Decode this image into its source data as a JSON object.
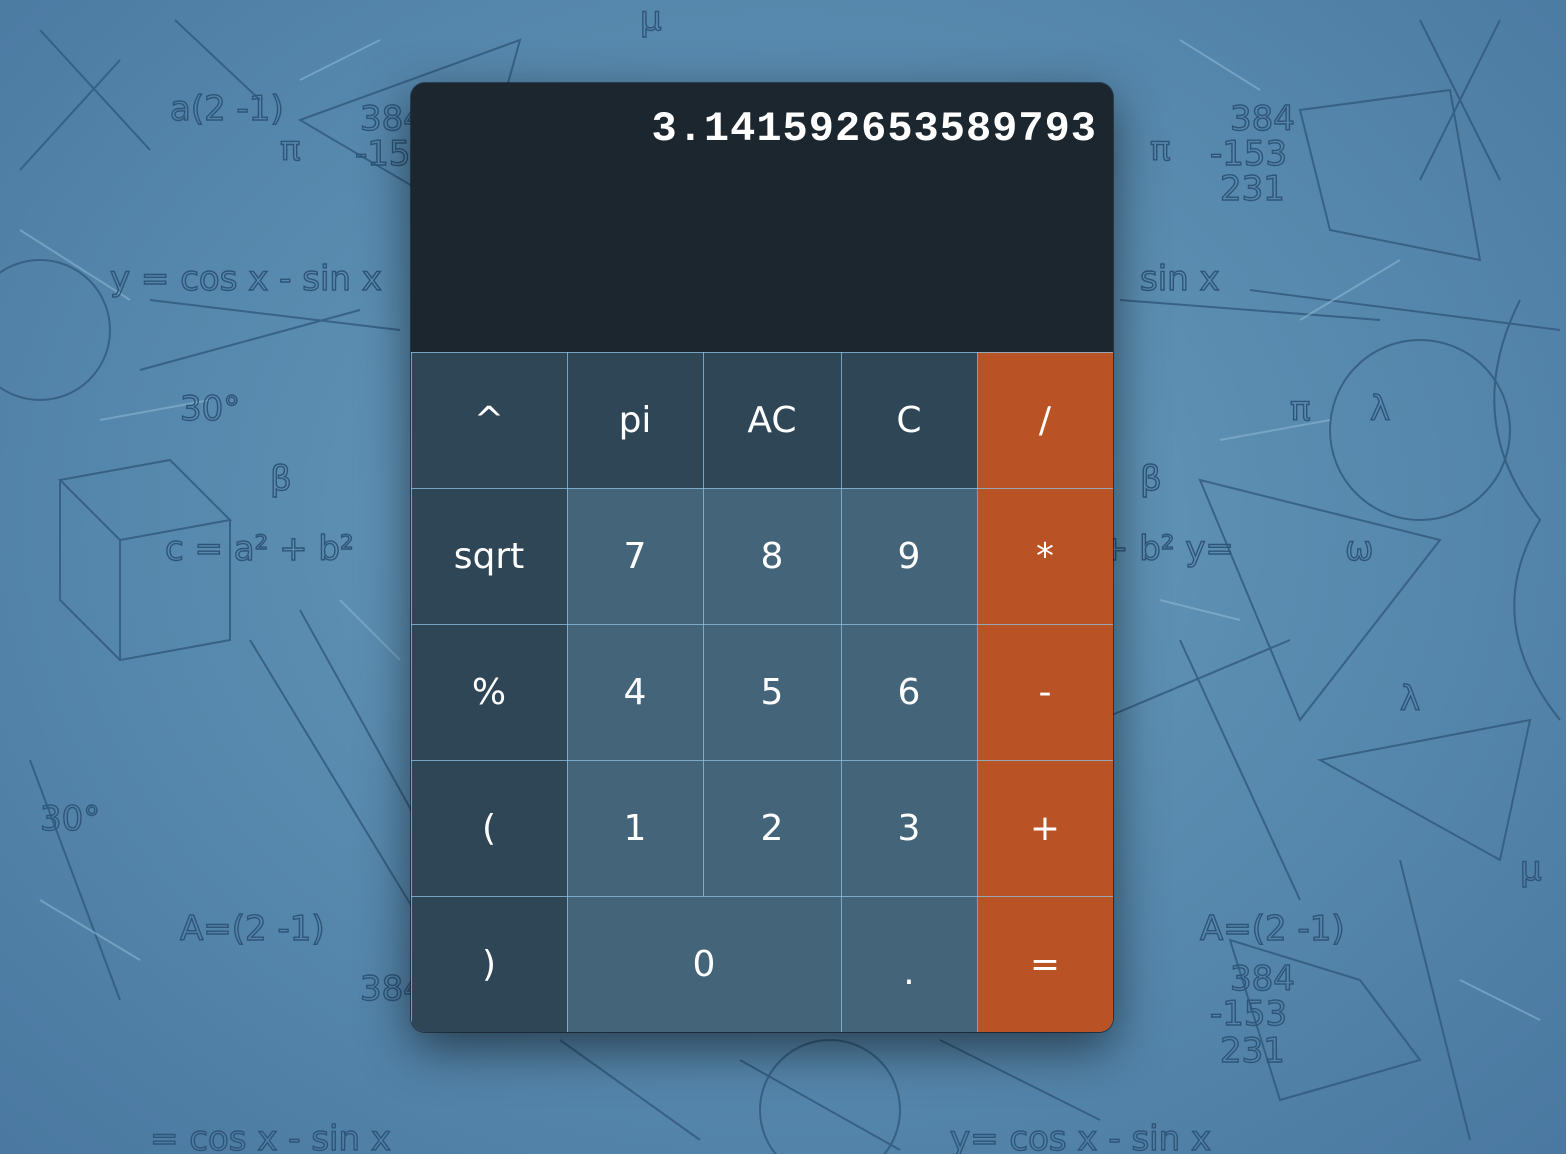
{
  "display": {
    "value": "3.141592653589793"
  },
  "keypad": {
    "rows": [
      [
        {
          "label": "^",
          "kind": "fn",
          "name": "power-key"
        },
        {
          "label": "pi",
          "kind": "fn",
          "name": "pi-key"
        },
        {
          "label": "AC",
          "kind": "fn",
          "name": "all-clear-key"
        },
        {
          "label": "C",
          "kind": "fn",
          "name": "clear-key"
        },
        {
          "label": "/",
          "kind": "op",
          "name": "divide-key"
        }
      ],
      [
        {
          "label": "sqrt",
          "kind": "fn",
          "name": "sqrt-key"
        },
        {
          "label": "7",
          "kind": "num",
          "name": "digit-7-key"
        },
        {
          "label": "8",
          "kind": "num",
          "name": "digit-8-key"
        },
        {
          "label": "9",
          "kind": "num",
          "name": "digit-9-key"
        },
        {
          "label": "*",
          "kind": "op",
          "name": "multiply-key"
        }
      ],
      [
        {
          "label": "%",
          "kind": "fn",
          "name": "percent-key"
        },
        {
          "label": "4",
          "kind": "num",
          "name": "digit-4-key"
        },
        {
          "label": "5",
          "kind": "num",
          "name": "digit-5-key"
        },
        {
          "label": "6",
          "kind": "num",
          "name": "digit-6-key"
        },
        {
          "label": "-",
          "kind": "op",
          "name": "subtract-key"
        }
      ],
      [
        {
          "label": "(",
          "kind": "fn",
          "name": "open-paren-key"
        },
        {
          "label": "1",
          "kind": "num",
          "name": "digit-1-key"
        },
        {
          "label": "2",
          "kind": "num",
          "name": "digit-2-key"
        },
        {
          "label": "3",
          "kind": "num",
          "name": "digit-3-key"
        },
        {
          "label": "+",
          "kind": "op",
          "name": "add-key"
        }
      ],
      [
        {
          "label": ")",
          "kind": "fn",
          "name": "close-paren-key"
        },
        {
          "label": "0",
          "kind": "num",
          "name": "digit-0-key",
          "wide": true
        },
        {
          "label": ".",
          "kind": "num",
          "name": "decimal-point-key"
        },
        {
          "label": "=",
          "kind": "op",
          "name": "equals-key"
        }
      ]
    ]
  },
  "colors": {
    "display_bg": "#1c262e",
    "function_key": "#2f4656",
    "number_key": "#446579",
    "operator_key": "#b95224",
    "grid_line": "#7fb8dc",
    "background": "#5a8cb0"
  }
}
